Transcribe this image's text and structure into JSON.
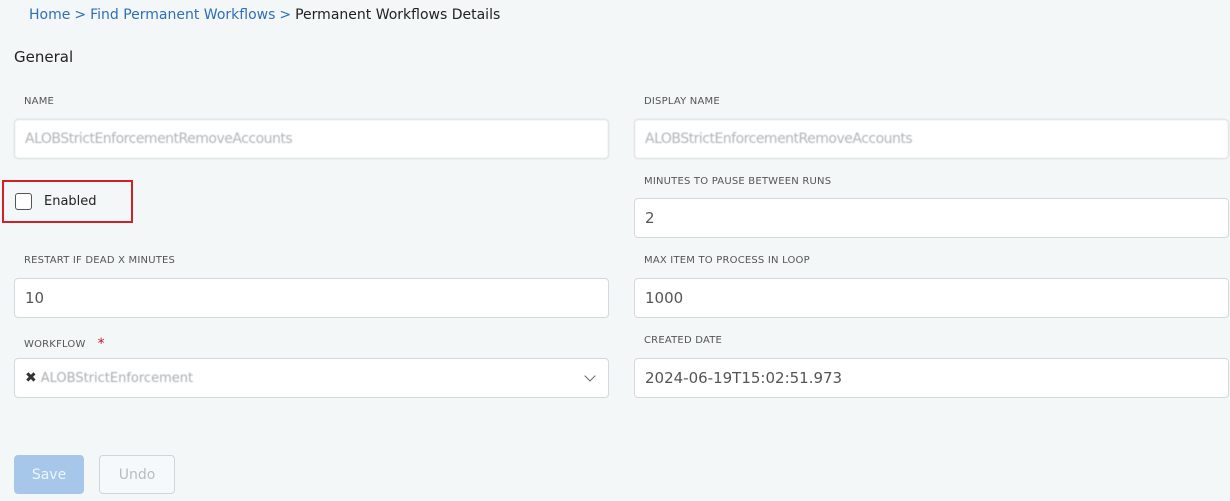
{
  "breadcrumb": {
    "home": "Home",
    "sep1": ">",
    "find": "Find Permanent Workflows",
    "sep2": ">",
    "current": "Permanent Workflows Details"
  },
  "section": {
    "title": "General"
  },
  "fields": {
    "name": {
      "label": "NAME",
      "value": "ALOBStrictEnforcementRemoveAccounts"
    },
    "display_name": {
      "label": "DISPLAY NAME",
      "value": "ALOBStrictEnforcementRemoveAccounts"
    },
    "enabled": {
      "label": "Enabled",
      "checked": false
    },
    "minutes_pause": {
      "label": "MINUTES TO PAUSE BETWEEN RUNS",
      "value": "2"
    },
    "restart_dead": {
      "label": "RESTART IF DEAD X MINUTES",
      "value": "10"
    },
    "max_items": {
      "label": "MAX ITEM TO PROCESS IN LOOP",
      "value": "1000"
    },
    "workflow": {
      "label": "WORKFLOW",
      "required_mark": "*",
      "value": "ALOBStrictEnforcement",
      "clear_glyph": "✖"
    },
    "created_date": {
      "label": "CREATED DATE",
      "value": "2024-06-19T15:02:51.973"
    }
  },
  "buttons": {
    "save": "Save",
    "undo": "Undo"
  },
  "colors": {
    "accent": "#2f6fb8",
    "highlight": "#d0212b",
    "required": "#c0142d"
  }
}
